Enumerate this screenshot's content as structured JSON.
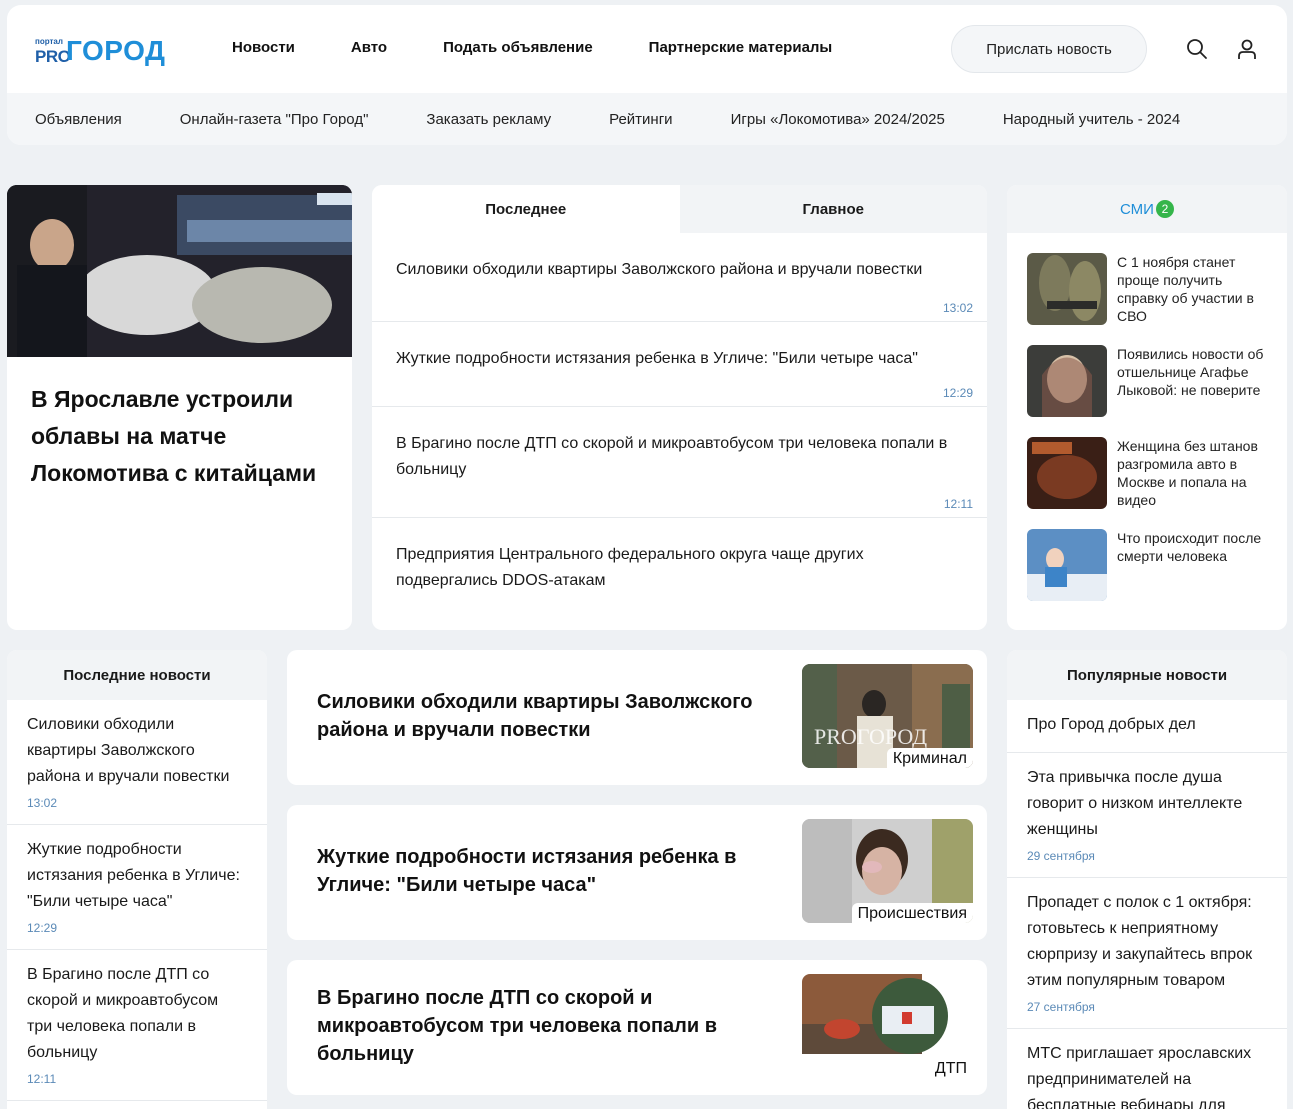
{
  "logo": {
    "portal": "портал",
    "pro": "PRO",
    "gorod": "ГОРОД"
  },
  "main_nav": [
    "Новости",
    "Авто",
    "Подать объявление",
    "Партнерские материалы"
  ],
  "send_news_label": "Прислать новость",
  "icons": {
    "search": "search-icon",
    "user": "user-icon"
  },
  "sub_nav": [
    "Объявления",
    "Онлайн-газета \"Про Город\"",
    "Заказать рекламу",
    "Рейтинги",
    "Игры «Локомотива» 2024/2025",
    "Народный учитель - 2024"
  ],
  "hero": {
    "title": "В Ярославле устроили облавы на матче Локомотива с китайцами"
  },
  "tabs": {
    "labels": [
      "Последнее",
      "Главное"
    ],
    "items": [
      {
        "title": "Силовики обходили квартиры Заволжского района и вручали повестки",
        "time": "13:02"
      },
      {
        "title": "Жуткие подробности истязания ребенка в Угличе: \"Били четыре часа\"",
        "time": "12:29"
      },
      {
        "title": "В Брагино после ДТП со скорой и микроавтобусом три человека попали в больницу",
        "time": "12:11"
      },
      {
        "title": "Предприятия Центрального федерального округа чаще других подвергались DDOS-атакам",
        "time": ""
      }
    ]
  },
  "smi": {
    "label": "СМИ",
    "badge": "2",
    "items": [
      {
        "title": "С 1 ноября станет проще получить справку об участии в СВО"
      },
      {
        "title": "Появились новости об отшельнице Агафье Лыковой: не поверите"
      },
      {
        "title": "Женщина без штанов разгромила авто в Москве и попала на видео"
      },
      {
        "title": "Что происходит после смерти человека"
      }
    ]
  },
  "latest": {
    "label": "Последние новости",
    "items": [
      {
        "title": "Силовики обходили квартиры Заволжского района и вручали повестки",
        "time": "13:02"
      },
      {
        "title": "Жуткие подробности истязания ребенка в Угличе: \"Били четыре часа\"",
        "time": "12:29"
      },
      {
        "title": "В Брагино после ДТП со скорой и микроавтобусом три человека попали в больницу",
        "time": "12:11"
      }
    ]
  },
  "news_cards": [
    {
      "title": "Силовики обходили квартиры Заволжского района и вручали повестки",
      "tag": "Криминал"
    },
    {
      "title": "Жуткие подробности истязания ребенка в Угличе: \"Били четыре часа\"",
      "tag": "Происшествия"
    },
    {
      "title": "В Брагино после ДТП со скорой и микроавтобусом три человека попали в больницу",
      "tag": "ДТП"
    }
  ],
  "popular": {
    "label": "Популярные новости",
    "items": [
      {
        "title": "Про Город добрых дел",
        "date": ""
      },
      {
        "title": "Эта привычка после душа говорит о низком интеллекте женщины",
        "date": "29 сентября"
      },
      {
        "title": "Пропадет с полок с 1 октября: готовьтесь к неприятному сюрпризу и закупайтесь впрок этим популярным товаром",
        "date": "27 сентября"
      },
      {
        "title": "МТС приглашает ярославских предпринимателей на бесплатные вебинары для",
        "date": ""
      }
    ]
  },
  "colors": {
    "accent": "#1f8ed8",
    "time": "#5b8ab7",
    "badge": "#35b54a",
    "bg": "#eef1f4"
  }
}
